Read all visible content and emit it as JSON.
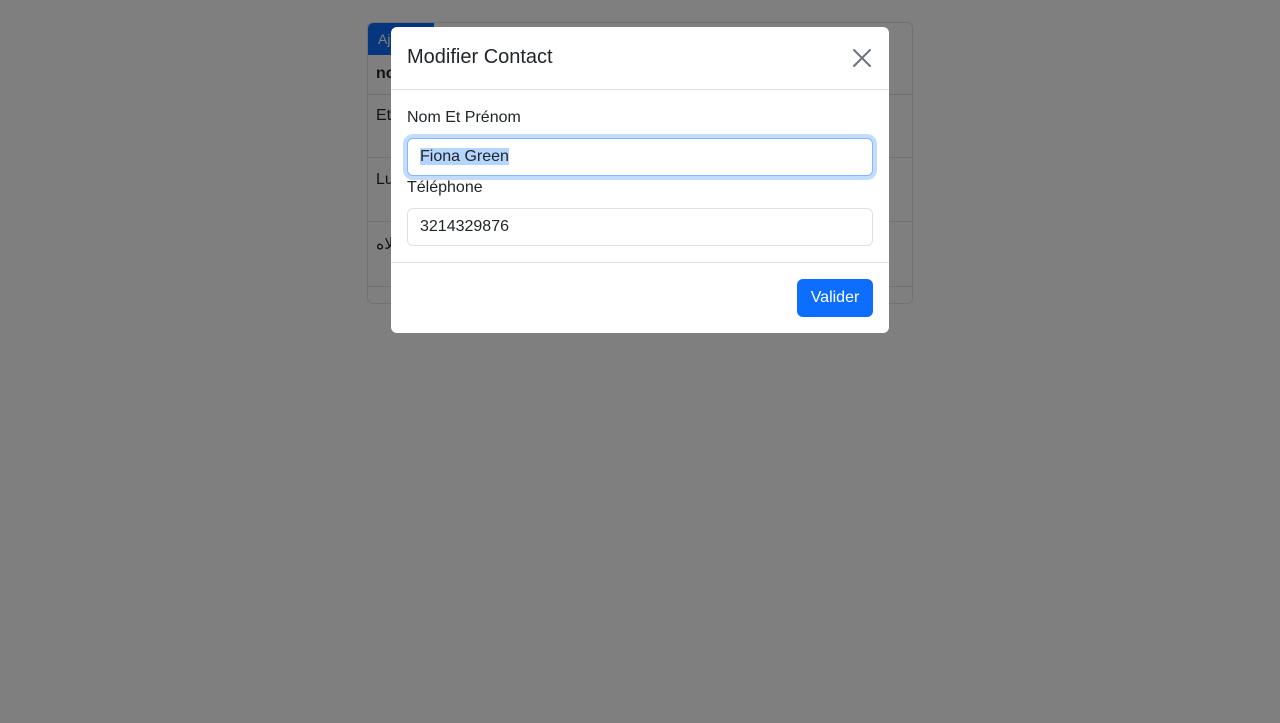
{
  "background": {
    "add_button_label": "Ajouter",
    "table_header_first": "nom",
    "rows": [
      "Et",
      "Lu",
      "ﻻه"
    ]
  },
  "modal": {
    "title": "Modifier Contact",
    "close_icon": "close-icon",
    "name_label": "Nom Et Prénom",
    "name_value": "Fiona Green",
    "phone_label": "Téléphone",
    "phone_value": "3214329876",
    "submit_label": "Valider"
  },
  "colors": {
    "primary": "#0d6efd",
    "focus_ring": "#86b7fe",
    "backdrop": "rgba(0,0,0,0.5)"
  }
}
